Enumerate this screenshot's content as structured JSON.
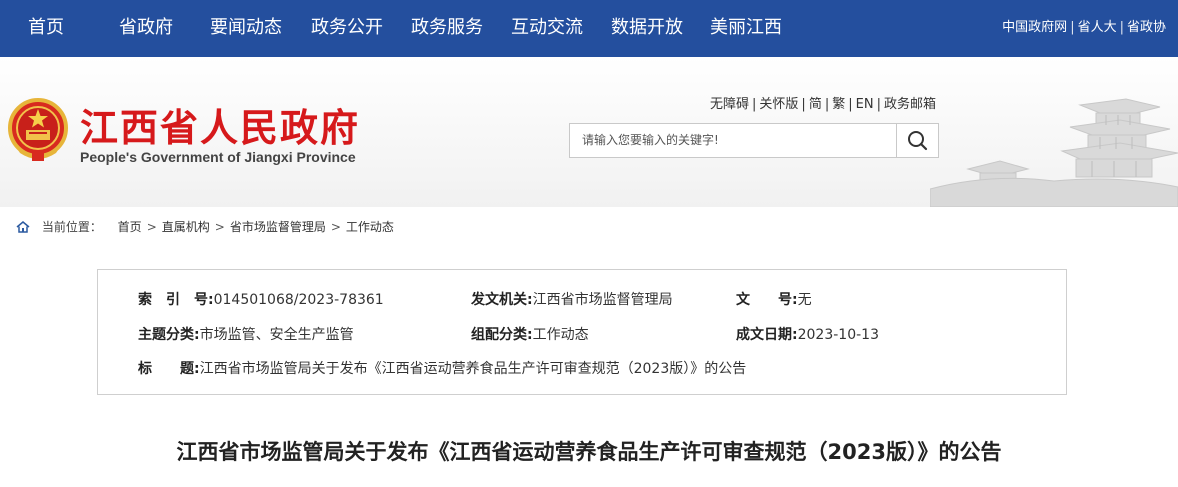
{
  "nav": {
    "items": [
      "首页",
      "省政府",
      "要闻动态",
      "政务公开",
      "政务服务",
      "互动交流",
      "数据开放",
      "美丽江西"
    ],
    "top_links": [
      "中国政府网",
      "省人大",
      "省政协"
    ]
  },
  "header": {
    "title": "江西省人民政府",
    "subtitle": "People's Government of Jiangxi Province",
    "access_links": [
      "无障碍",
      "关怀版",
      "简",
      "繁",
      "EN",
      "政务邮箱"
    ],
    "search_placeholder": "请输入您要输入的关键字!"
  },
  "breadcrumb": {
    "label": "当前位置：",
    "items": [
      "首页",
      "直属机构",
      "省市场监督管理局",
      "工作动态"
    ]
  },
  "info": {
    "index_label": "索　引　号:",
    "index_value": "014501068/2023-78361",
    "issuer_label": "发文机关:",
    "issuer_value": "江西省市场监督管理局",
    "docno_label": "文　　号:",
    "docno_value": "无",
    "topic_label": "主题分类:",
    "topic_value": "市场监管、安全生产监管",
    "category_label": "组配分类:",
    "category_value": "工作动态",
    "date_label": "成文日期:",
    "date_value": "2023-10-13",
    "title_label": "标　　题:",
    "title_value": "江西省市场监管局关于发布《江西省运动营养食品生产许可审查规范（2023版）》的公告"
  },
  "document": {
    "title": "江西省市场监管局关于发布《江西省运动营养食品生产许可审查规范（2023版）》的公告"
  },
  "colors": {
    "nav_bg": "#244f9e",
    "title_red": "#d6191b"
  }
}
